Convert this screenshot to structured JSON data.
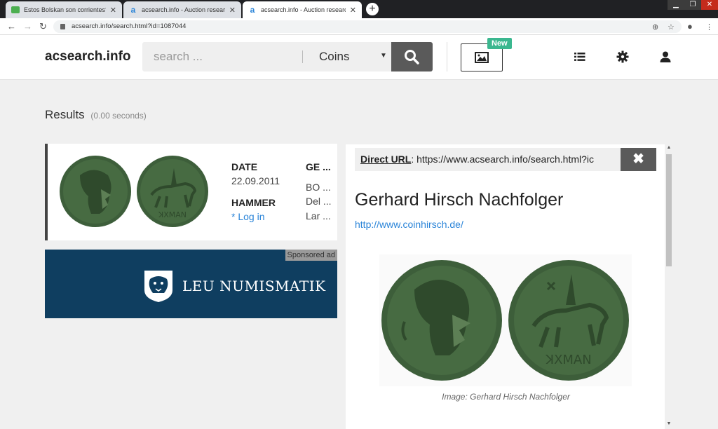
{
  "browser": {
    "tabs": [
      {
        "title": "Estos Bolskan son corrientes? no"
      },
      {
        "title": "acsearch.info - Auction research"
      },
      {
        "title": "acsearch.info - Auction research"
      }
    ],
    "newtab_label": "+",
    "address": "acsearch.info/search.html?id=1087044",
    "nav": {
      "back": "←",
      "forward": "→",
      "reload": "↻"
    }
  },
  "header": {
    "logo": "acsearch.info",
    "search_placeholder": "search ...",
    "category": "Coins",
    "new_badge": "New"
  },
  "results": {
    "title": "Results",
    "time": "(0.00 seconds)"
  },
  "result_card": {
    "date_label": "DATE",
    "date_value": "22.09.2011",
    "hammer_label": "HAMMER",
    "login_text": "* Log in",
    "ge_label": "GE ...",
    "desc_lines": [
      "BO ...",
      "Del ...",
      "Lar ..."
    ]
  },
  "ad": {
    "tag": "Sponsored ad",
    "brand": "LEU NUMISMATIK"
  },
  "detail": {
    "direct_url_label": "Direct URL",
    "direct_url_value": ": https://www.acsearch.info/search.html?ic",
    "close_label": "✖",
    "auction_house": "Gerhard Hirsch Nachfolger",
    "link": "http://www.coinhirsch.de/",
    "caption": "Image: Gerhard Hirsch Nachfolger"
  },
  "colors": {
    "accent": "#2a84d8",
    "badge": "#3bb78f",
    "ad_bg": "#0f3e60",
    "coin": "#3d5e3a"
  }
}
